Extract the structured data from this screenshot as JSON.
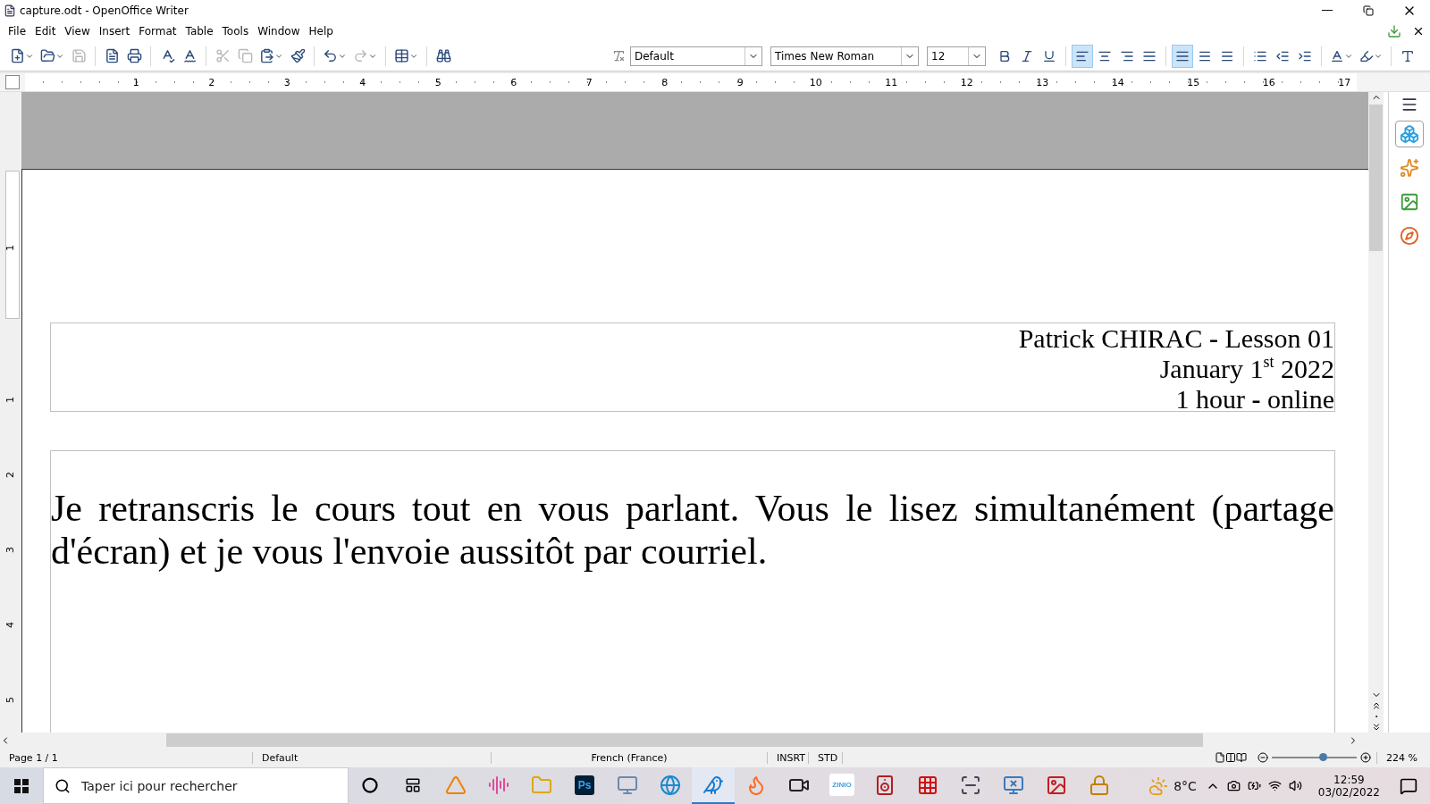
{
  "window": {
    "title": "capture.odt - OpenOffice Writer"
  },
  "menu": [
    {
      "label": "File"
    },
    {
      "label": "Edit"
    },
    {
      "label": "View"
    },
    {
      "label": "Insert"
    },
    {
      "label": "Format"
    },
    {
      "label": "Table"
    },
    {
      "label": "Tools"
    },
    {
      "label": "Window"
    },
    {
      "label": "Help"
    }
  ],
  "standard_toolbar": [
    {
      "disabled": false
    },
    {
      "disabled": false
    },
    {
      "disabled": true
    },
    {
      "disabled": false
    },
    {
      "disabled": false
    },
    {
      "disabled": false
    },
    {
      "disabled": false
    },
    {
      "disabled": true
    },
    {
      "disabled": true
    },
    {
      "disabled": false
    },
    {
      "disabled": false
    },
    {
      "disabled": false
    },
    {
      "disabled": true
    },
    {
      "disabled": false
    },
    {
      "disabled": false
    }
  ],
  "formatting_toolbar": {
    "paragraph_style": "Default",
    "font_name": "Times New Roman",
    "font_size": "12",
    "buttons": [
      {
        "selected": false
      },
      {
        "selected": false
      },
      {
        "selected": false
      },
      {
        "selected": true
      },
      {
        "selected": false
      },
      {
        "selected": false
      },
      {
        "selected": false
      },
      {
        "selected": true
      },
      {
        "selected": false
      },
      {
        "selected": false
      },
      {
        "selected": false
      },
      {
        "selected": false
      },
      {
        "selected": false
      },
      {
        "selected": false
      },
      {
        "selected": false
      },
      {
        "selected": false
      }
    ]
  },
  "ruler": {
    "horizontal": [
      "1",
      "2",
      "3",
      "4",
      "5",
      "6",
      "7",
      "8",
      "9",
      "10",
      "11",
      "12",
      "13",
      "14",
      "15",
      "16",
      "17"
    ],
    "vertical": [
      "1",
      "1",
      "2",
      "3",
      "4",
      "5"
    ]
  },
  "document": {
    "header_lines": [
      "Patrick CHIRAC **-** Lesson 01",
      "January 1$^{st}$ 2022",
      "1 hour **-** online"
    ],
    "body": "Je retranscris le cours tout en vous parlant. Vous le lisez simultanément (partage d'écran) et je vous l'envoie aussitôt par courriel."
  },
  "sidebar": [
    {
      "selected": true
    },
    {
      "selected": false
    },
    {
      "selected": false
    },
    {
      "selected": false
    }
  ],
  "status_bar": {
    "page": "Page 1 / 1",
    "page_style": "Default",
    "language": "French (France)",
    "insert_mode": "INSRT",
    "selection_mode": "STD",
    "zoom": {
      "level": 0.6
    },
    "zoom_percent": "224 %"
  },
  "taskbar": {
    "search_placeholder": "Taper ici pour rechercher",
    "apps": [
      {
        "selected": false
      },
      {
        "selected": false
      },
      {
        "selected": false
      },
      {
        "selected": false,
        "label": "Ps"
      },
      {
        "selected": false
      },
      {
        "selected": false
      },
      {
        "selected": true
      },
      {
        "selected": false
      },
      {
        "selected": false
      },
      {
        "selected": false,
        "label": "ZINIO"
      },
      {
        "selected": false
      },
      {
        "selected": false
      },
      {
        "selected": false
      },
      {
        "selected": false
      },
      {
        "selected": false
      },
      {
        "selected": false
      }
    ],
    "weather": "8°C",
    "time": "12:59",
    "date": "03/02/2022"
  }
}
